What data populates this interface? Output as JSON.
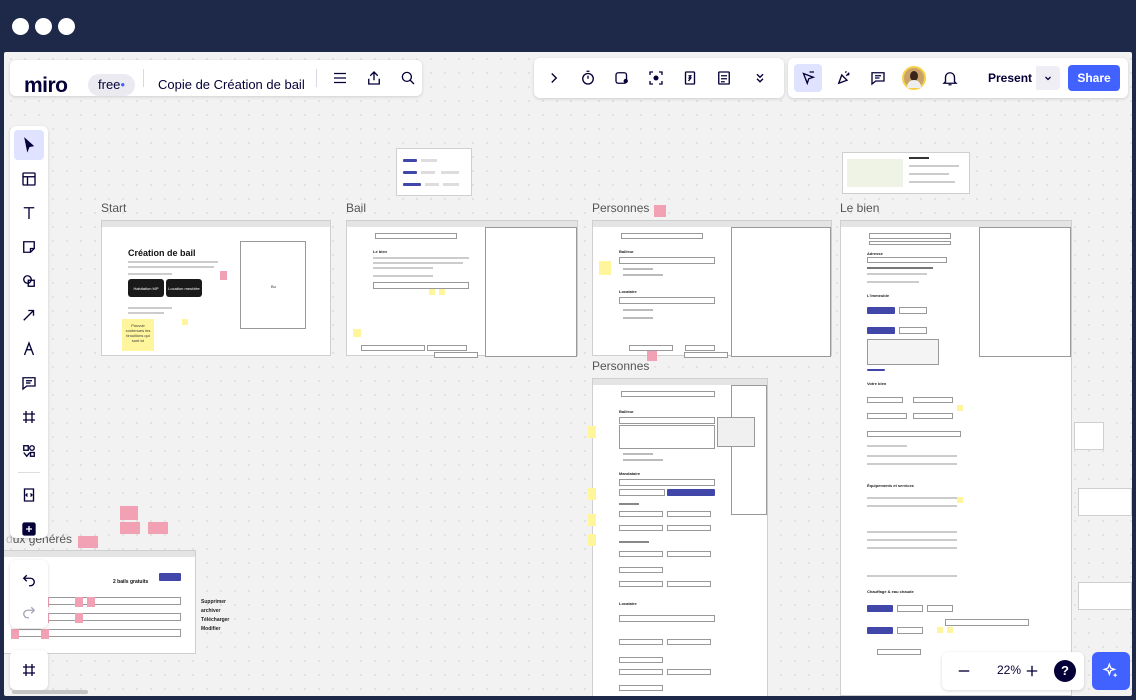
{
  "app": {
    "logo": "miro",
    "plan_badge": "free",
    "board_title": "Copie de Création de bail"
  },
  "header": {
    "present_label": "Present",
    "share_label": "Share"
  },
  "frames": {
    "start": "Start",
    "bail": "Bail",
    "personnes_1": "Personnes",
    "personnes_2": "Personnes",
    "le_bien": "Le bien",
    "generated_partial": "ux générés"
  },
  "start_frame": {
    "title": "Création de bail",
    "btn_habitation": "Habitation MP",
    "btn_location": "Location meublée",
    "sticky": "Pouvoir contenues les brouillons qui sont ici",
    "placeholder": "Bu"
  },
  "generated_frame": {
    "count_title": "2 bails gratuits",
    "side_menu": [
      "Supprimer",
      "archiver",
      "Télécharger",
      "Modifier"
    ]
  },
  "zoom": {
    "level": "22%"
  },
  "icons": {
    "accent": "#4262ff",
    "chrome": "#1e2848"
  }
}
